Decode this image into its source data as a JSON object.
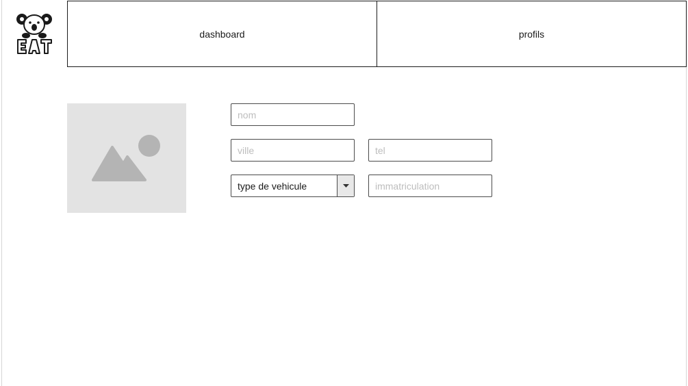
{
  "app": {
    "logo_text": "EAT"
  },
  "nav": {
    "tabs": [
      {
        "label": "dashboard"
      },
      {
        "label": "profils"
      }
    ]
  },
  "profile": {
    "photo_icon": "image-placeholder-icon"
  },
  "form": {
    "nom": {
      "placeholder": "nom",
      "value": ""
    },
    "ville": {
      "placeholder": "ville",
      "value": ""
    },
    "tel": {
      "placeholder": "tel",
      "value": ""
    },
    "vehicle_type": {
      "selected": "type de vehicule"
    },
    "immatriculation": {
      "placeholder": "immatriculation",
      "value": ""
    }
  },
  "colors": {
    "border": "#4a4a4a",
    "placeholder_text": "#bdbdbd",
    "image_bg": "#e3e3e3",
    "image_fg": "#b4b4b4"
  }
}
